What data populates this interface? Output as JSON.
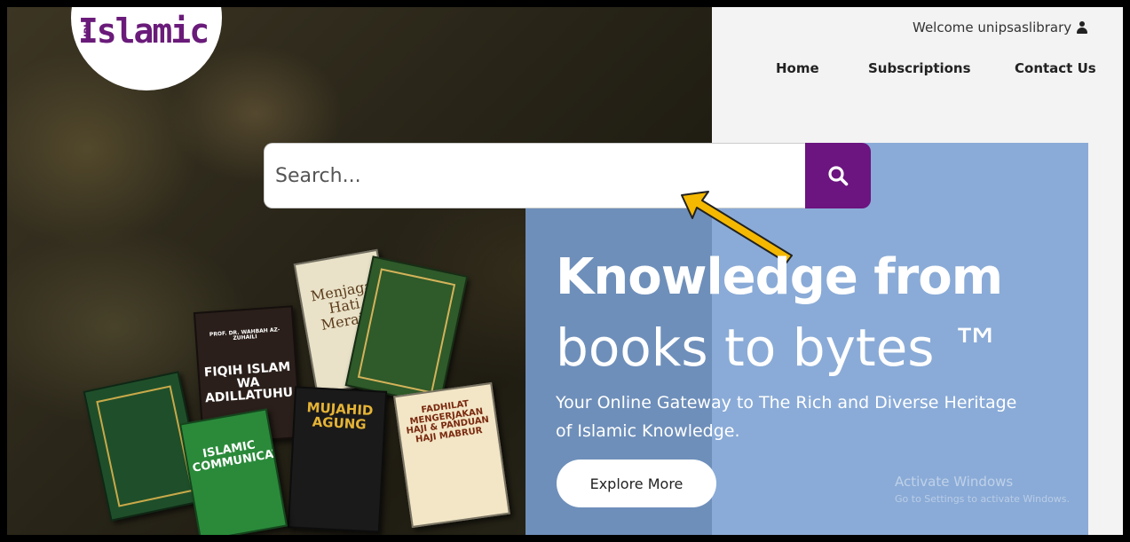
{
  "brand": {
    "logo_text": "Islamic",
    "logo_prefix": "UPL"
  },
  "header": {
    "welcome_text": "Welcome unipsaslibrary",
    "nav": [
      {
        "label": "Home"
      },
      {
        "label": "Subscriptions"
      },
      {
        "label": "Contact Us"
      }
    ]
  },
  "search": {
    "placeholder": "Search...",
    "button_icon": "search-icon"
  },
  "hero": {
    "headline_bold": "Knowledge from",
    "headline_light": "books to bytes ™",
    "tagline": "Your Online Gateway to The Rich and Diverse Heritage of Islamic Knowledge.",
    "cta_label": "Explore More"
  },
  "books": [
    {
      "title": "FIQIH ISLAM WA ADILLATUHU",
      "author": "PROF. DR. WAHBAH AZ-ZUHAILI"
    },
    {
      "title": "Menjaga Hati Meraih"
    },
    {
      "title": "MUJAHID AGUNG"
    },
    {
      "title": "FADHILAT MENGERJAKAN HAJI & PANDUAN HAJI MABRUR"
    },
    {
      "title": "ISLAMIC COMMUNICATION"
    }
  ],
  "watermark": {
    "line1": "Activate Windows",
    "line2": "Go to Settings to activate Windows."
  },
  "colors": {
    "accent": "#6c1480",
    "hero_blue": "#8aabd7",
    "arrow": "#f5b800"
  }
}
